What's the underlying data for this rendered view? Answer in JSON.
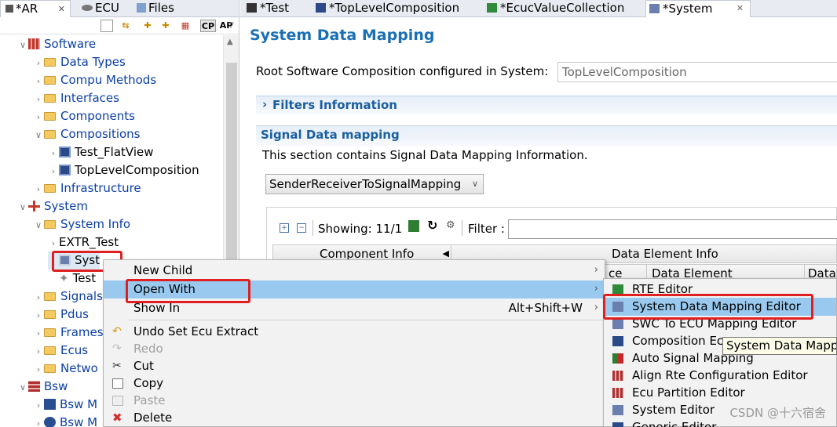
{
  "left_panel": {
    "tabs": [
      {
        "label": "*AR",
        "close": "✕"
      },
      {
        "label": "ECU"
      },
      {
        "label": "Files"
      }
    ],
    "toolbar": {
      "cp": "CP",
      "ap": "AP"
    },
    "tree": [
      {
        "label": "Software",
        "icon": "software-icon"
      },
      {
        "label": "Data Types",
        "icon": "folder-icon"
      },
      {
        "label": "Compu Methods",
        "icon": "folder-icon"
      },
      {
        "label": "Interfaces",
        "icon": "folder-icon"
      },
      {
        "label": "Components",
        "icon": "folder-icon"
      },
      {
        "label": "Compositions",
        "icon": "folder-icon"
      },
      {
        "label": "Test_FlatView",
        "icon": "composition-icon"
      },
      {
        "label": "TopLevelComposition",
        "icon": "composition-icon"
      },
      {
        "label": "Infrastructure",
        "icon": "folder-icon"
      },
      {
        "label": "System",
        "icon": "system-icon"
      },
      {
        "label": "System Info",
        "icon": "folder-icon"
      },
      {
        "label": "EXTR_Test"
      },
      {
        "label": "Syst",
        "icon": "system-info-icon"
      },
      {
        "label": "Test",
        "icon": "star-icon"
      },
      {
        "label": "Signals",
        "icon": "folder-icon"
      },
      {
        "label": "Pdus",
        "icon": "folder-icon"
      },
      {
        "label": "Frames",
        "icon": "folder-icon"
      },
      {
        "label": "Ecus",
        "icon": "folder-icon"
      },
      {
        "label": "Netwo",
        "icon": "folder-icon"
      },
      {
        "label": "Bsw",
        "icon": "bsw-icon"
      },
      {
        "label": "Bsw M",
        "icon": "bsw-module-icon"
      },
      {
        "label": "Bsw M",
        "icon": "bsw-module-icon"
      }
    ]
  },
  "editor": {
    "tabs": [
      {
        "label": "*Test"
      },
      {
        "label": "*TopLevelComposition"
      },
      {
        "label": "*EcucValueCollection"
      },
      {
        "label": "*System",
        "close": "✕"
      }
    ],
    "title": "System Data Mapping",
    "root_label": "Root Software Composition configured in System:",
    "root_value": "TopLevelComposition",
    "filters_header": "Filters Information",
    "filters_arrow": "›",
    "signal_header": "Signal Data mapping",
    "signal_desc": "This section contains Signal Data Mapping Information.",
    "mapping_type": "SenderReceiverToSignalMapping",
    "showing": "Showing: 11/1",
    "filter_label": "Filter :",
    "col_component": "Component Info",
    "col_data_element_info": "Data Element Info",
    "col_ce": "ce",
    "col_data_element": "Data Element",
    "col_data": "Data"
  },
  "context_menu": [
    {
      "label": "New Child",
      "submenu": "›"
    },
    {
      "label": "Open With",
      "submenu": "›",
      "highlighted": true
    },
    {
      "label": "Show In",
      "shortcut": "Alt+Shift+W",
      "submenu": "›"
    },
    {
      "label": "Undo Set Ecu Extract",
      "icon": "undo-icon"
    },
    {
      "label": "Redo",
      "icon": "redo-icon",
      "disabled": true
    },
    {
      "label": "Cut",
      "icon": "cut-icon"
    },
    {
      "label": "Copy",
      "icon": "copy-icon"
    },
    {
      "label": "Paste",
      "icon": "paste-icon",
      "disabled": true
    },
    {
      "label": "Delete",
      "icon": "delete-icon"
    }
  ],
  "submenu": [
    {
      "label": "RTE Editor",
      "icon": "rte-icon"
    },
    {
      "label": "System Data Mapping Editor",
      "icon": "system-data-mapping-icon",
      "highlighted": true
    },
    {
      "label": "SWC To ECU Mapping Editor",
      "icon": "swc-ecu-mapping-icon"
    },
    {
      "label": "Composition Ec",
      "icon": "composition-editor-icon"
    },
    {
      "label": "Auto Signal Mapping",
      "icon": "auto-signal-icon"
    },
    {
      "label": "Align Rte Configuration Editor",
      "icon": "align-rte-icon"
    },
    {
      "label": "Ecu Partition Editor",
      "icon": "ecu-partition-icon"
    },
    {
      "label": "System Editor",
      "icon": "system-editor-icon"
    },
    {
      "label": "Generic Editor",
      "icon": "generic-editor-icon"
    }
  ],
  "tooltip": "System Data Mapping Editor",
  "watermark": "CSDN @十六宿舍",
  "colors": {
    "accent": "#1a6fb5",
    "highlight": "#99c9ef",
    "callout": "#e02020"
  }
}
